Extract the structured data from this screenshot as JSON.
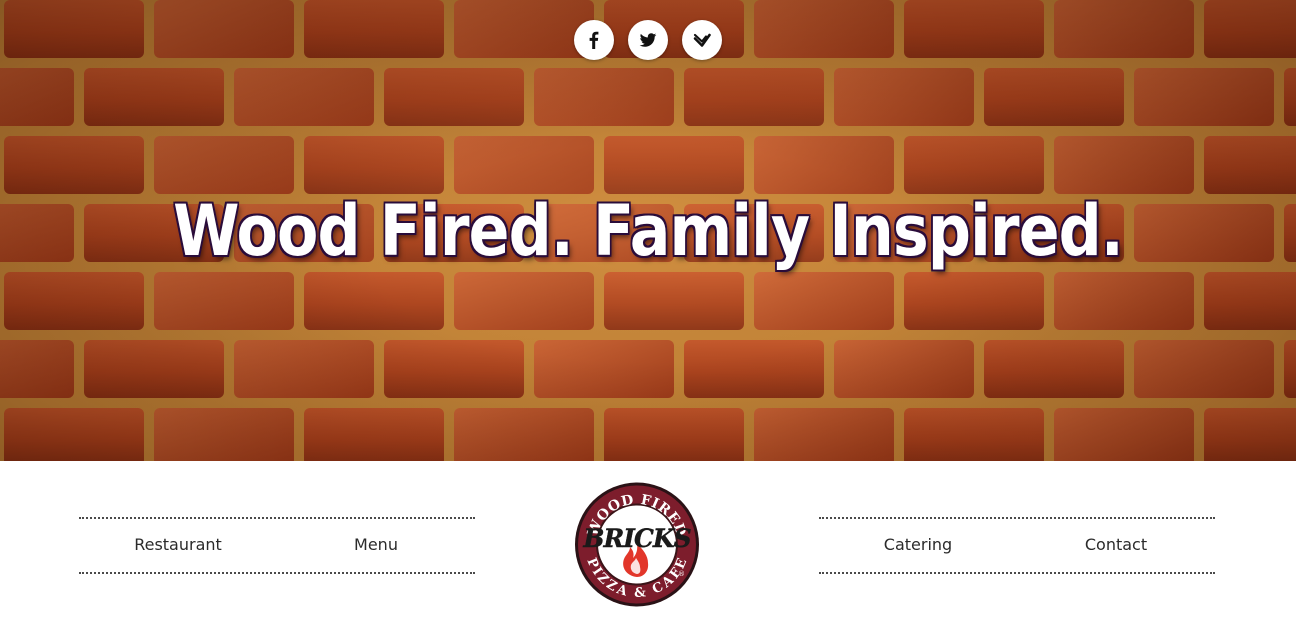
{
  "hero": {
    "tagline": "Wood Fired. Family Inspired.",
    "social": [
      {
        "name": "facebook",
        "icon": "facebook-icon"
      },
      {
        "name": "twitter",
        "icon": "twitter-icon"
      },
      {
        "name": "foursquare",
        "icon": "foursquare-icon"
      }
    ]
  },
  "logo": {
    "top_text": "WOOD FIRED",
    "brand": "BRICKS",
    "bottom_text": "PIZZA & CAFE",
    "registered": "®"
  },
  "nav": {
    "left": [
      "Restaurant",
      "Menu"
    ],
    "right": [
      "Catering",
      "Contact"
    ]
  },
  "colors": {
    "brick": "#b9481f",
    "mortar": "#d7913e",
    "logo_ring": "#7d1d2c",
    "flame": "#e2362a",
    "nav_text": "#2b2b2b"
  }
}
